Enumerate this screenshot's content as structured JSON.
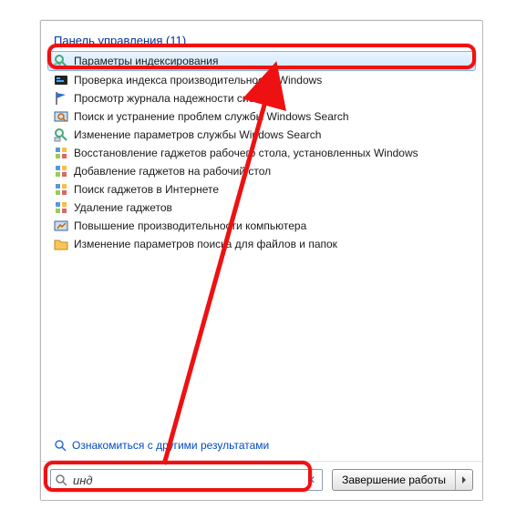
{
  "header": {
    "title": "Панель управления",
    "count": 11
  },
  "results": [
    {
      "icon": "indexing-options-icon",
      "label": "Параметры индексирования",
      "selected": true
    },
    {
      "icon": "perf-index-icon",
      "label": "Проверка индекса производительности Windows"
    },
    {
      "icon": "flag-icon",
      "label": "Просмотр журнала надежности системы"
    },
    {
      "icon": "search-fix-icon",
      "label": "Поиск и устранение проблем службы Windows Search"
    },
    {
      "icon": "search-settings-icon",
      "label": "Изменение параметров службы Windows Search"
    },
    {
      "icon": "gadget-restore-icon",
      "label": "Восстановление гаджетов рабочего стола, установленных Windows"
    },
    {
      "icon": "gadget-add-icon",
      "label": "Добавление гаджетов на рабочий стол"
    },
    {
      "icon": "gadget-web-icon",
      "label": "Поиск гаджетов в Интернете"
    },
    {
      "icon": "gadget-del-icon",
      "label": "Удаление гаджетов"
    },
    {
      "icon": "perf-boost-icon",
      "label": "Повышение производительности компьютера"
    },
    {
      "icon": "folder-search-icon",
      "label": "Изменение параметров поиска для файлов и папок"
    }
  ],
  "more_link": "Ознакомиться с другими результатами",
  "search": {
    "value": "инд",
    "placeholder": ""
  },
  "action_button": {
    "label": "Завершение работы"
  }
}
